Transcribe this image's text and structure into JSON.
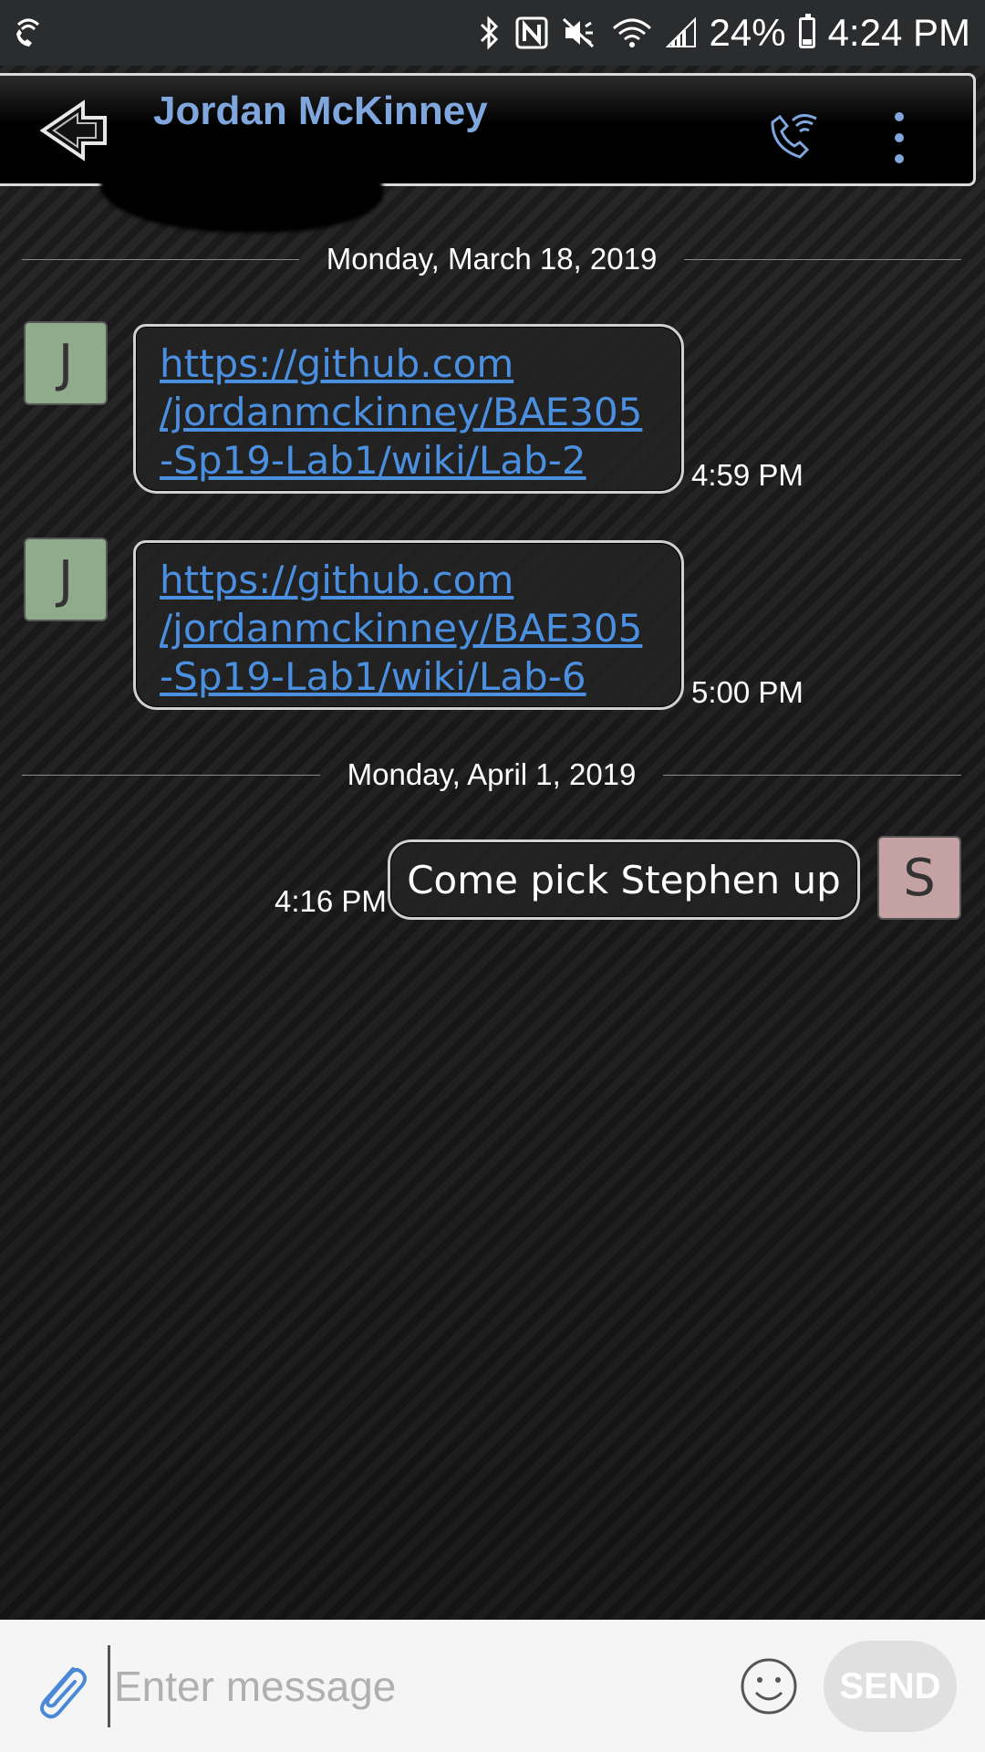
{
  "status_bar": {
    "battery_percent": "24%",
    "time": "4:24 PM",
    "icons": [
      "wifi-call-icon",
      "bluetooth-icon",
      "nfc-icon",
      "mute-icon",
      "wifi-icon",
      "signal-icon",
      "battery-icon"
    ]
  },
  "header": {
    "contact_name": "Jordan McKinney",
    "icons": [
      "back-icon",
      "call-icon",
      "more-icon"
    ],
    "accent_color": "#7fa6dd"
  },
  "conversation": {
    "groups": [
      {
        "date": "Monday, March 18, 2019",
        "messages": [
          {
            "direction": "incoming",
            "avatar": "J",
            "lines": [
              "https://github.com",
              "/jordanmckinney/BAE305",
              "-Sp19-Lab1/wiki/Lab-2"
            ],
            "time": "4:59 PM"
          },
          {
            "direction": "incoming",
            "avatar": "J",
            "lines": [
              "https://github.com",
              "/jordanmckinney/BAE305",
              "-Sp19-Lab1/wiki/Lab-6"
            ],
            "time": "5:00 PM"
          }
        ]
      },
      {
        "date": "Monday, April 1, 2019",
        "messages": [
          {
            "direction": "outgoing",
            "avatar": "S",
            "text": "Come pick Stephen up",
            "time": "4:16 PM"
          }
        ]
      }
    ]
  },
  "composer": {
    "placeholder": "Enter message",
    "send_label": "SEND",
    "icons": [
      "attach-icon",
      "emoji-icon"
    ]
  },
  "colors": {
    "link": "#4b8fe0",
    "avatar_j": "#8fab8c",
    "avatar_s": "#c4a1a3"
  }
}
